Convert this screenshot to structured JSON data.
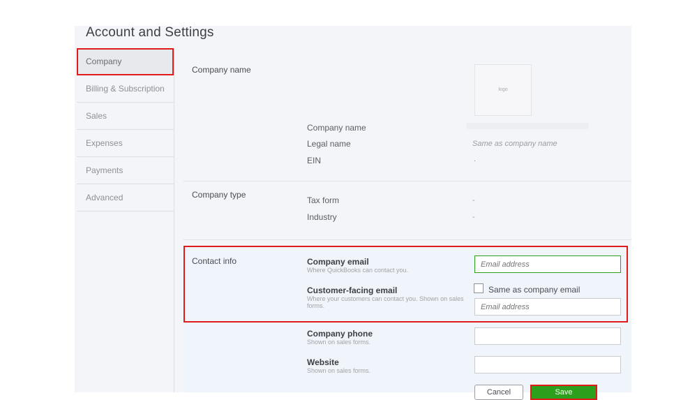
{
  "page": {
    "title": "Account and Settings"
  },
  "sidebar": {
    "items": [
      {
        "label": "Company"
      },
      {
        "label": "Billing & Subscription"
      },
      {
        "label": "Sales"
      },
      {
        "label": "Expenses"
      },
      {
        "label": "Payments"
      },
      {
        "label": "Advanced"
      }
    ]
  },
  "company_name_section": {
    "label": "Company name",
    "logo_text": "logo",
    "rows": [
      {
        "label": "Company name",
        "value": ""
      },
      {
        "label": "Legal name",
        "value": "Same as company name"
      },
      {
        "label": "EIN",
        "value": "."
      }
    ]
  },
  "company_type_section": {
    "label": "Company type",
    "rows": [
      {
        "label": "Tax form",
        "value": "-"
      },
      {
        "label": "Industry",
        "value": "-"
      }
    ]
  },
  "contact_info": {
    "label": "Contact info",
    "company_email": {
      "label": "Company email",
      "help": "Where QuickBooks can contact you.",
      "placeholder": "Email address"
    },
    "customer_facing_email": {
      "label": "Customer-facing email",
      "help": "Where your customers can contact you. Shown on sales forms.",
      "checkbox_label": "Same as company email",
      "placeholder": "Email address"
    },
    "company_phone": {
      "label": "Company phone",
      "help": "Shown on sales forms."
    },
    "website": {
      "label": "Website",
      "help": "Shown on sales forms."
    }
  },
  "actions": {
    "cancel_label": "Cancel",
    "save_label": "Save"
  },
  "colors": {
    "accent_green": "#2ca01c",
    "highlight_red": "#e01b1b"
  }
}
